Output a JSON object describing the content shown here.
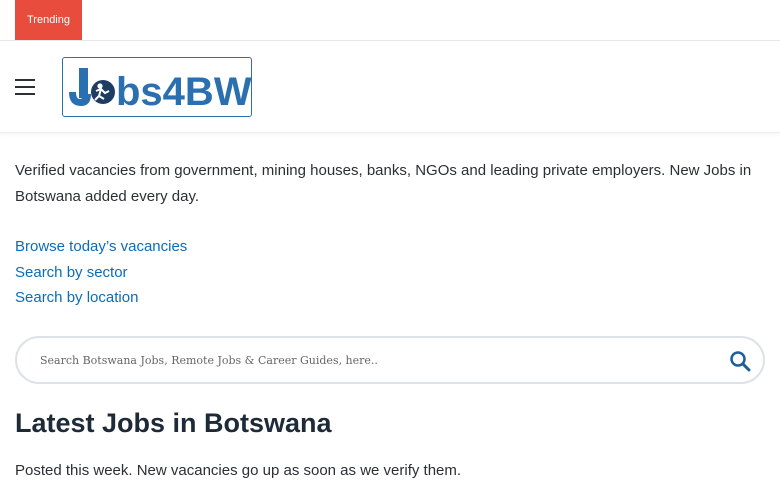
{
  "topbar": {
    "trending_label": "Trending"
  },
  "header": {
    "logo_text": "Jobs4BW",
    "brand_colors": {
      "blue": "#2a6fb0",
      "dark": "#1f3c63"
    }
  },
  "intro": {
    "text": "Verified vacancies from government, mining houses, banks, NGOs and leading private employers. New Jobs in Botswana added every day."
  },
  "links": [
    {
      "label": "Browse today’s vacancies"
    },
    {
      "label": "Search by sector"
    },
    {
      "label": "Search by location"
    }
  ],
  "search": {
    "placeholder": "Search Botswana Jobs, Remote Jobs & Career Guides, here..",
    "icon": "search-icon"
  },
  "latest": {
    "title": "Latest Jobs in Botswana",
    "subtitle": "Posted this week. New vacancies go up as soon as we verify them."
  },
  "colors": {
    "accent": "#e74c3c",
    "link": "#0c6cb8",
    "heading": "#1f2a38"
  }
}
